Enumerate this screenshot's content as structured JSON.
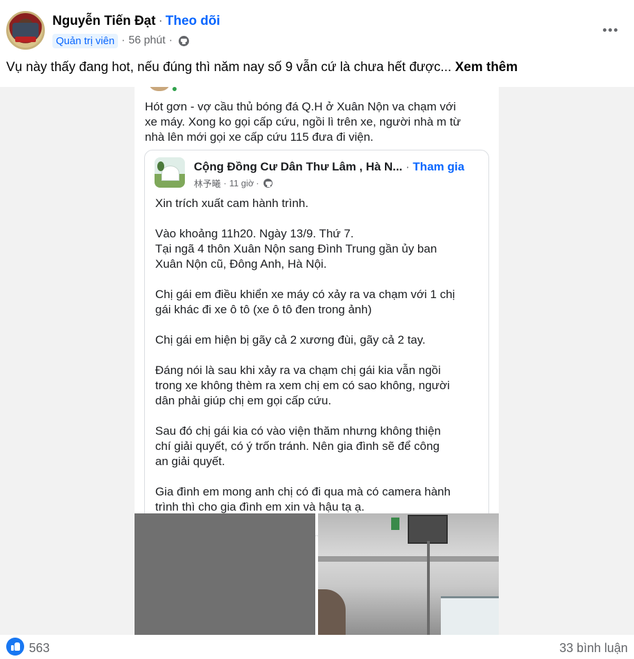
{
  "post": {
    "author": "Nguyễn Tiến Đạt",
    "separator": "·",
    "follow_label": "Theo dõi",
    "role": "Quản trị viên",
    "meta_separator": "·",
    "time": "56 phút",
    "audience_icon": "globe-icon",
    "caption": "Vụ này thấy đang hot, nếu đúng thì năm nay số 9 vẫn cứ là chưa hết được...",
    "see_more": "Xem thêm"
  },
  "screenshot": {
    "intro_lines": [
      "Hót gơn - vợ cầu thủ bóng đá Q.H ở Xuân Nộn va chạm với",
      "xe máy. Xong ko gọi cấp cứu, ngồi lì trên xe, người nhà m từ",
      "nhà lên mới gọi xe cấp cứu 115 đưa đi viện."
    ],
    "shared_post": {
      "group_name": "Cộng Đồng Cư Dân Thư Lâm , Hà N...",
      "separator": "·",
      "join_label": "Tham gia",
      "poster": "林予曦",
      "meta_separator": "·",
      "time": "11 giờ",
      "audience_icon": "globe-icon",
      "paragraphs": [
        [
          "Xin trích xuất cam hành trình."
        ],
        [
          "Vào khoảng 11h20. Ngày 13/9. Thứ 7.",
          "Tại ngã 4 thôn Xuân Nộn sang Đình Trung gần ủy ban",
          "Xuân Nộn cũ, Đông Anh, Hà Nội."
        ],
        [
          "Chị gái em điều khiển xe máy có xảy ra va chạm với 1 chị",
          "gái khác đi xe ô tô (xe ô tô đen trong ảnh)"
        ],
        [
          "Chị gái em hiện bị gãy cả 2 xương đùi, gãy cả 2 tay."
        ],
        [
          "Đáng nói là sau khi xảy ra va chạm chị gái kia vẫn ngồi",
          "trong xe không thèm ra xem chị em có sao không, người",
          "dân phải giúp chị em gọi cấp cứu."
        ],
        [
          "Sau đó chị gái kia có vào viện thăm nhưng không thiện",
          "chí giải quyết, có ý trốn tránh. Nên gia đình sẽ để công",
          "an giải quyết."
        ],
        [
          "Gia đình em mong anh chị có đi qua mà có camera hành",
          "trình thì cho gia đình em xin và hậu tạ ạ."
        ]
      ]
    }
  },
  "footer": {
    "reaction_icon": "like-icon",
    "like_count": "563",
    "comment_count": "33 bình luận"
  },
  "colors": {
    "link_blue": "#0866ff",
    "secondary_text": "#65676b",
    "like_blue": "#1877f2"
  }
}
